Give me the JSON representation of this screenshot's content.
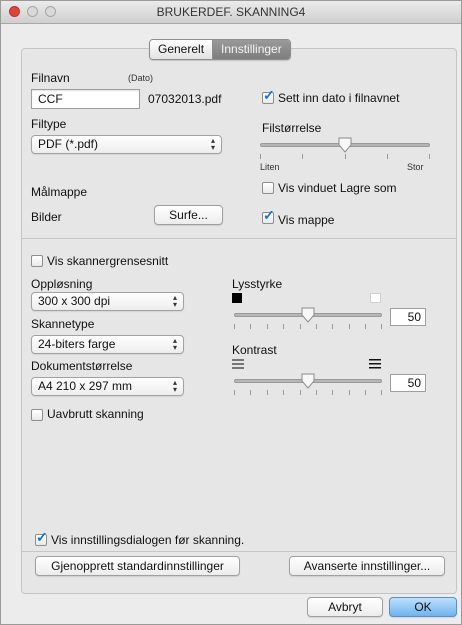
{
  "window": {
    "title": "BRUKERDEF. SKANNING4"
  },
  "tabs": [
    {
      "label": "Generelt",
      "active": false
    },
    {
      "label": "Innstillinger",
      "active": true
    }
  ],
  "file": {
    "filename_label": "Filnavn",
    "date_label": "(Dato)",
    "filename_value": "CCF",
    "filename_suffix": "07032013.pdf",
    "insert_date_label": "Sett inn dato i filnavnet",
    "insert_date_checked": true,
    "filetype_label": "Filtype",
    "filetype_value": "PDF (*.pdf)",
    "filesize_label": "Filstørrelse",
    "filesize_min": "Liten",
    "filesize_max": "Stor",
    "filesize_level": 0.5,
    "target_folder_label": "Målmappe",
    "target_folder_value": "Bilder",
    "browse_label": "Surfe...",
    "show_save_window_label": "Vis vinduet Lagre som",
    "show_save_window_checked": false,
    "show_folder_label": "Vis mappe",
    "show_folder_checked": true
  },
  "scan": {
    "show_scanner_ui_label": "Vis skannergrensesnitt",
    "show_scanner_ui_checked": false,
    "resolution_label": "Oppløsning",
    "resolution_value": "300 x 300 dpi",
    "scan_type_label": "Skannetype",
    "scan_type_value": "24-biters farge",
    "doc_size_label": "Dokumentstørrelse",
    "doc_size_value": "A4 210 x 297 mm",
    "continuous_label": "Uavbrutt skanning",
    "continuous_checked": false,
    "brightness_label": "Lysstyrke",
    "brightness_value": "50",
    "contrast_label": "Kontrast",
    "contrast_value": "50"
  },
  "footer": {
    "show_dialog_label": "Vis innstillingsdialogen før skanning.",
    "show_dialog_checked": true,
    "restore_defaults_label": "Gjenopprett standardinnstillinger",
    "advanced_label": "Avanserte innstillinger..."
  },
  "actions": {
    "cancel_label": "Avbryt",
    "ok_label": "OK"
  },
  "colors": {
    "accent": "#6fb3ef",
    "close": "#e0443e",
    "check": "#1a6fd0"
  }
}
